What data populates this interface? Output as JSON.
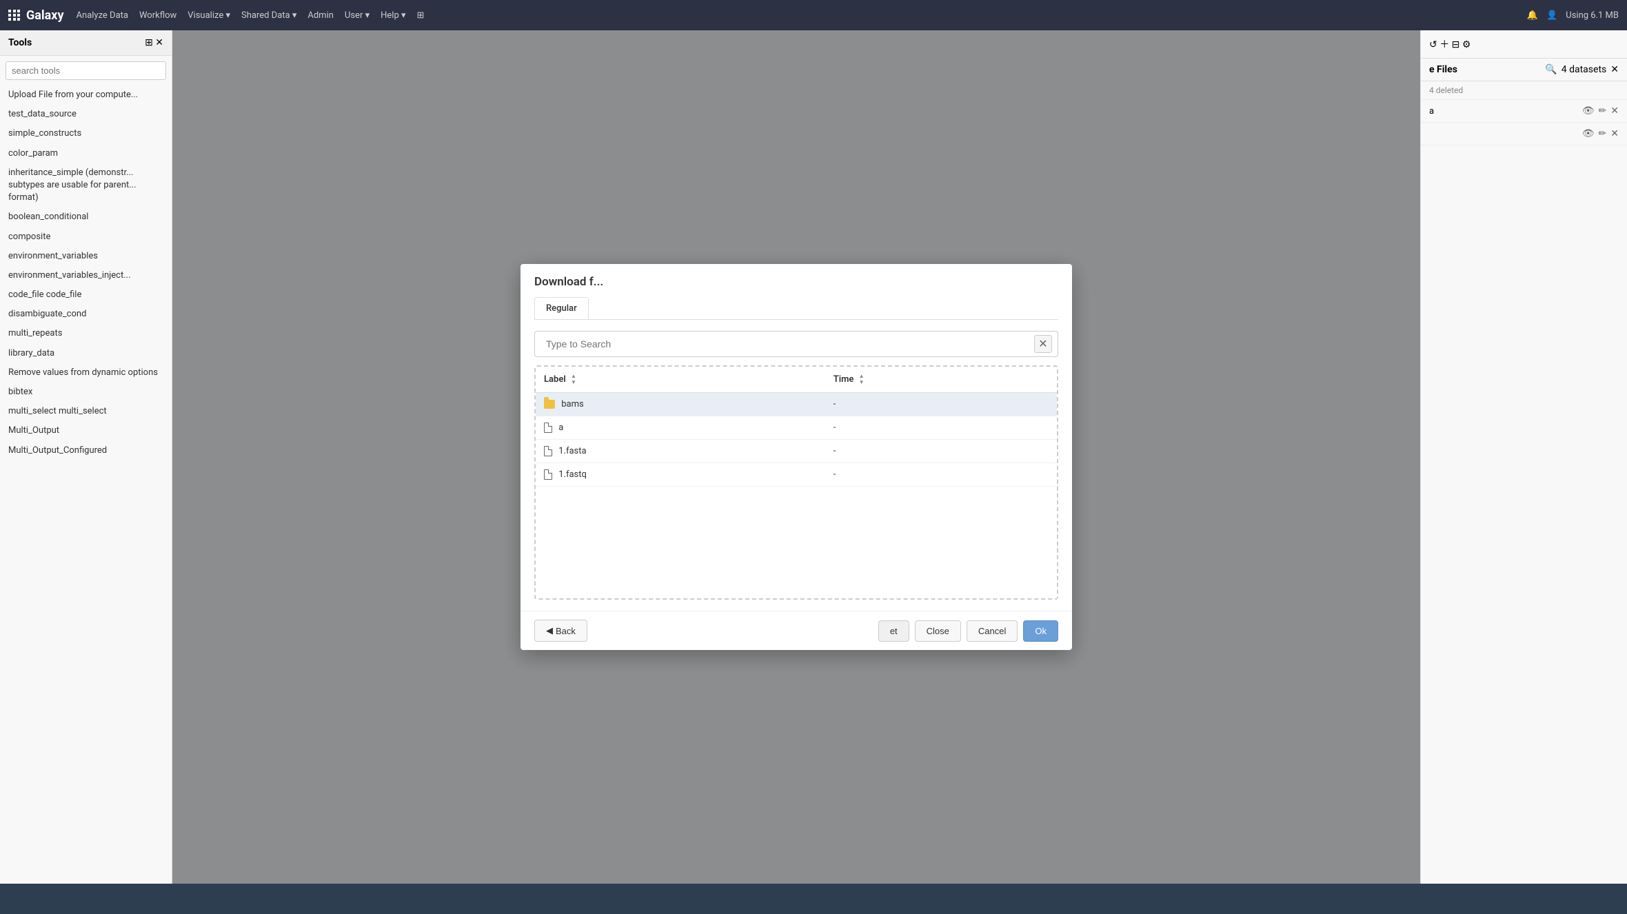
{
  "navbar": {
    "brand": "Galaxy",
    "links": [
      "Analyze Data",
      "Workflow",
      "Visualize ▾",
      "Shared Data ▾",
      "Admin",
      "User ▾",
      "Help ▾"
    ],
    "grid_icon": "grid-icon",
    "right_text": "Using 6.1 MB"
  },
  "sidebar": {
    "title": "Tools",
    "search_placeholder": "search tools",
    "items": [
      {
        "label": "Upload File from your compute..."
      },
      {
        "label": "test_data_source"
      },
      {
        "label": "simple_constructs"
      },
      {
        "label": "color_param"
      },
      {
        "label": "inheritance_simple (demonstr... subtypes are usable for parent... format)"
      },
      {
        "label": "boolean_conditional"
      },
      {
        "label": "composite"
      },
      {
        "label": "environment_variables"
      },
      {
        "label": "environment_variables_inject..."
      },
      {
        "label": "code_file code_file"
      },
      {
        "label": "disambiguate_cond"
      },
      {
        "label": "multi_repeats"
      },
      {
        "label": "library_data"
      },
      {
        "label": "Remove values from dynamic options"
      },
      {
        "label": "bibtex"
      },
      {
        "label": "multi_select multi_select"
      },
      {
        "label": "Multi_Output"
      },
      {
        "label": "Multi_Output_Configured"
      }
    ]
  },
  "right_panel": {
    "title": "e Files",
    "subtitle": "4 deleted",
    "items": [
      {
        "label": "a",
        "icons": [
          "👁",
          "✏",
          "✕"
        ]
      },
      {
        "label": "",
        "icons": [
          "👁",
          "✏",
          "✕"
        ]
      }
    ]
  },
  "modal": {
    "title": "Download f...",
    "tabs": [
      {
        "label": "Regular",
        "active": true
      }
    ],
    "search_placeholder": "Type to Search",
    "file_table": {
      "columns": [
        {
          "label": "Label",
          "sortable": true
        },
        {
          "label": "Time",
          "sortable": true
        }
      ],
      "rows": [
        {
          "icon": "folder",
          "name": "bams",
          "time": "-",
          "highlighted": true
        },
        {
          "icon": "doc",
          "name": "a",
          "time": "-",
          "highlighted": false
        },
        {
          "icon": "doc",
          "name": "1.fasta",
          "time": "-",
          "highlighted": false
        },
        {
          "icon": "doc",
          "name": "1.fastq",
          "time": "-",
          "highlighted": false
        }
      ]
    },
    "footer": {
      "back_label": "Back",
      "cancel_label": "Cancel",
      "ok_label": "Ok",
      "extra_label": "et"
    }
  }
}
